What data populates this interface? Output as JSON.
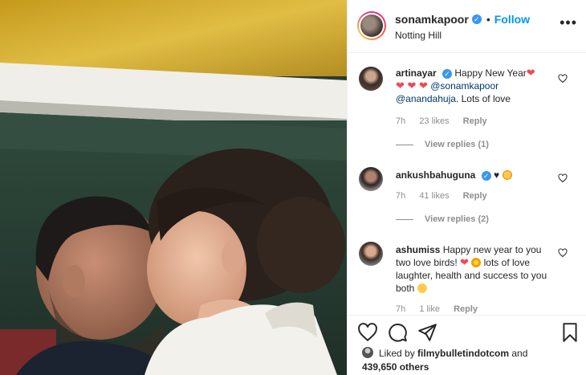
{
  "post": {
    "username": "sonamkapoor",
    "verified_mark": "✓",
    "separator": "•",
    "follow_label": "Follow",
    "location": "Notting Hill",
    "more_icon": "•••"
  },
  "comments": [
    {
      "username": "artinayar",
      "verified": true,
      "text_pre": " Happy New Year",
      "hearts_inline": "❤",
      "hearts_line": "❤ ❤ ❤",
      "mention1": "@sonamkapoor",
      "mention2": "@anandahuja",
      "text_post": ". Lots of love",
      "time": "7h",
      "likes": "23 likes",
      "reply_label": "Reply",
      "view_replies": "View replies (1)"
    },
    {
      "username": "ankushbahuguna",
      "verified": true,
      "text": "♥",
      "time": "7h",
      "likes": "41 likes",
      "reply_label": "Reply",
      "view_replies": "View replies (2)"
    },
    {
      "username": "ashumiss",
      "text": " Happy new year to you two love birds! ",
      "text_heart": "❤",
      "text_post": " lots of love laughter, health and success to you both ",
      "time": "7h",
      "likes": "1 like",
      "reply_label": "Reply"
    }
  ],
  "liked_by": {
    "prefix": "Liked by ",
    "user": "filmybulletindotcom",
    "and": " and",
    "count": "439,650 others"
  },
  "colors": {
    "accent": "#0095f6",
    "verified": "#3897f0",
    "heart": "#ed4956",
    "meta_text": "#8e8e8e"
  }
}
